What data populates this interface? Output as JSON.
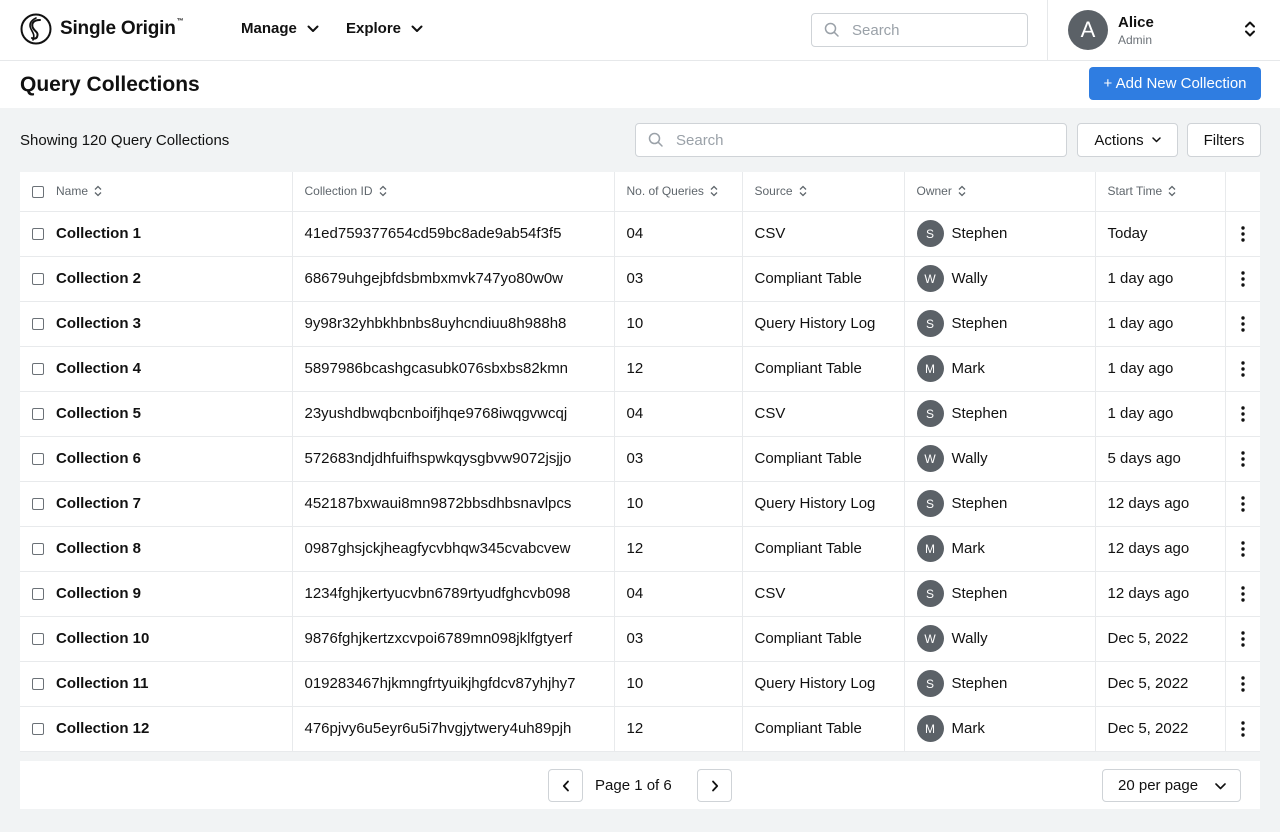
{
  "brand": {
    "name": "Single Origin",
    "tm": "™"
  },
  "nav": [
    {
      "label": "Manage"
    },
    {
      "label": "Explore"
    }
  ],
  "top_search": {
    "placeholder": "Search"
  },
  "user": {
    "initial": "A",
    "name": "Alice",
    "role": "Admin"
  },
  "page": {
    "title": "Query Collections",
    "add_label": "+ Add New Collection"
  },
  "toolbar": {
    "showing": "Showing 120 Query Collections",
    "search_placeholder": "Search",
    "actions_label": "Actions",
    "filters_label": "Filters"
  },
  "table": {
    "headers": {
      "name": "Name",
      "collection_id": "Collection ID",
      "queries": "No. of Queries",
      "source": "Source",
      "owner": "Owner",
      "start_time": "Start Time"
    },
    "rows": [
      {
        "name": "Collection 1",
        "id": "41ed759377654cd59bc8ade9ab54f3f5",
        "queries": "04",
        "source": "CSV",
        "owner_initial": "S",
        "owner": "Stephen",
        "time": "Today"
      },
      {
        "name": "Collection 2",
        "id": "68679uhgejbfdsbmbxmvk747yo80w0w",
        "queries": "03",
        "source": "Compliant Table",
        "owner_initial": "W",
        "owner": "Wally",
        "time": "1 day ago"
      },
      {
        "name": "Collection 3",
        "id": "9y98r32yhbkhbnbs8uyhcndiuu8h988h8",
        "queries": "10",
        "source": "Query History Log",
        "owner_initial": "S",
        "owner": "Stephen",
        "time": "1 day ago"
      },
      {
        "name": "Collection 4",
        "id": "5897986bcashgcasubk076sbxbs82kmn",
        "queries": "12",
        "source": "Compliant Table",
        "owner_initial": "M",
        "owner": "Mark",
        "time": "1 day ago"
      },
      {
        "name": "Collection 5",
        "id": "23yushdbwqbcnboifjhqe9768iwqgvwcqj",
        "queries": "04",
        "source": "CSV",
        "owner_initial": "S",
        "owner": "Stephen",
        "time": "1 day ago"
      },
      {
        "name": "Collection 6",
        "id": "572683ndjdhfuifhspwkqysgbvw9072jsjjo",
        "queries": "03",
        "source": "Compliant Table",
        "owner_initial": "W",
        "owner": "Wally",
        "time": "5 days ago"
      },
      {
        "name": "Collection 7",
        "id": "452187bxwaui8mn9872bbsdhbsnavlpcs",
        "queries": "10",
        "source": "Query History Log",
        "owner_initial": "S",
        "owner": "Stephen",
        "time": "12 days ago"
      },
      {
        "name": "Collection 8",
        "id": "0987ghsjckjheagfycvbhqw345cvabcvew",
        "queries": "12",
        "source": "Compliant Table",
        "owner_initial": "M",
        "owner": "Mark",
        "time": "12 days ago"
      },
      {
        "name": "Collection 9",
        "id": "1234fghjkertyucvbn6789rtyudfghcvb098",
        "queries": "04",
        "source": "CSV",
        "owner_initial": "S",
        "owner": "Stephen",
        "time": "12 days ago"
      },
      {
        "name": "Collection 10",
        "id": "9876fghjkertzxcvpoi6789mn098jklfgtyerf",
        "queries": "03",
        "source": "Compliant Table",
        "owner_initial": "W",
        "owner": "Wally",
        "time": "Dec 5, 2022"
      },
      {
        "name": "Collection 11",
        "id": "019283467hjkmngfrtyuikjhgfdcv87yhjhy7",
        "queries": "10",
        "source": "Query History Log",
        "owner_initial": "S",
        "owner": "Stephen",
        "time": "Dec 5, 2022"
      },
      {
        "name": "Collection 12",
        "id": "476pjvy6u5eyr6u5i7hvgjytwery4uh89pjh",
        "queries": "12",
        "source": "Compliant Table",
        "owner_initial": "M",
        "owner": "Mark",
        "time": "Dec 5, 2022"
      }
    ]
  },
  "pagination": {
    "label": "Page 1 of 6",
    "per_page": "20 per page"
  },
  "icons": {
    "logo": "single-origin-logo-icon",
    "search": "search-icon",
    "chevron": "chevron-down-icon",
    "switch": "up-down-chevron-icon",
    "sort": "sort-icon",
    "kebab": "kebab-menu-icon",
    "prev": "chevron-left-icon",
    "next": "chevron-right-icon"
  },
  "colors": {
    "accent": "#2f7de1",
    "avatar": "#5b6167",
    "background": "#f1f3f4"
  }
}
